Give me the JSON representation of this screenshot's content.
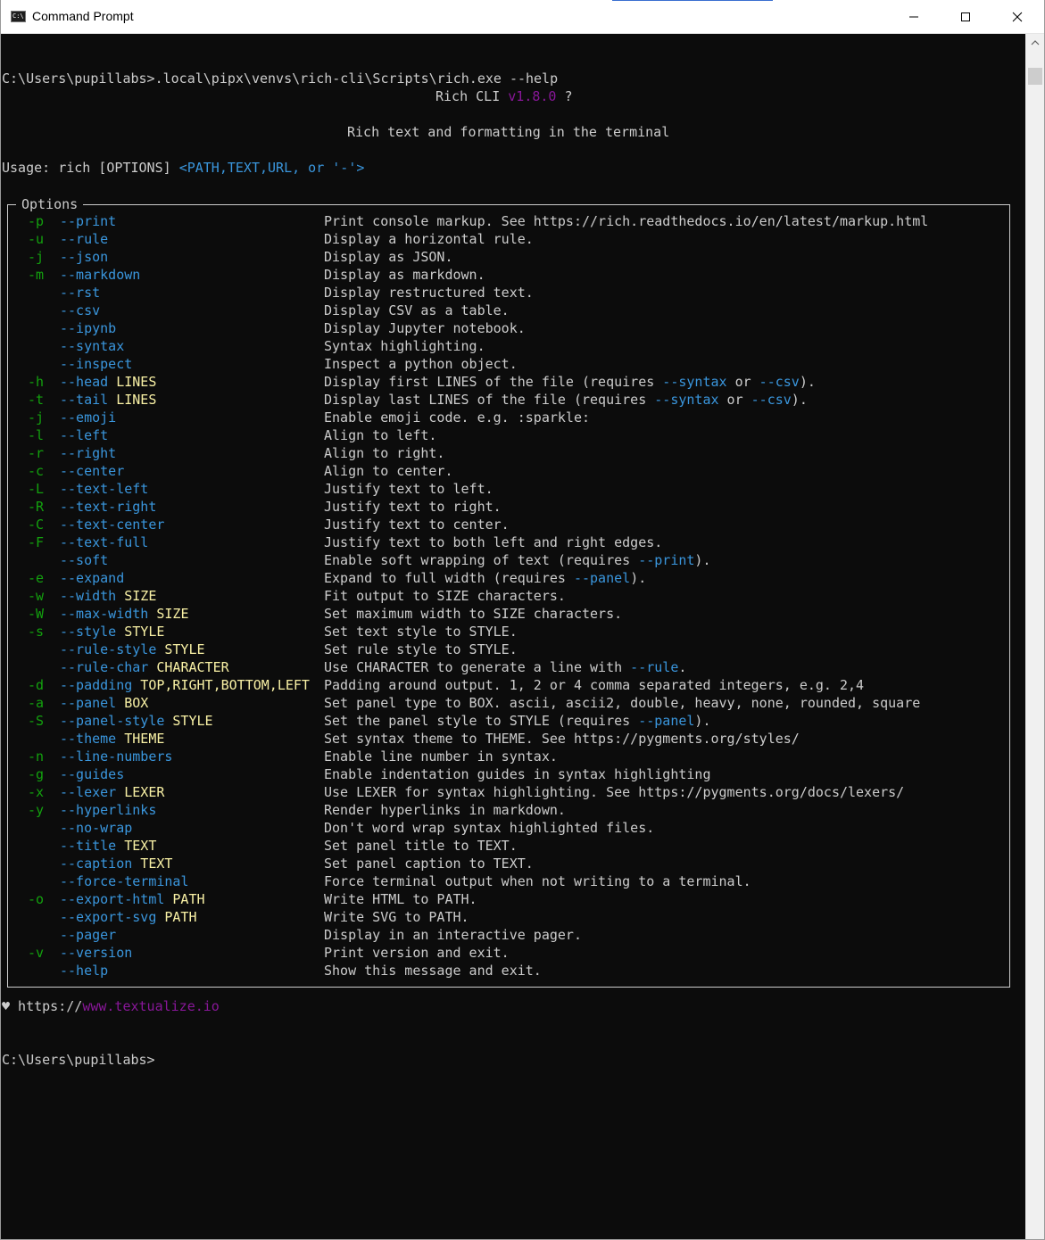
{
  "window": {
    "title": "Command Prompt",
    "icon": "cmd-icon",
    "controls": [
      "minimize-icon",
      "maximize-icon",
      "close-icon"
    ]
  },
  "colors": {
    "background": "#0c0c0c",
    "text": "#cccccc",
    "short_flag": "#13a10e",
    "long_flag": "#3a96dd",
    "metavar": "#f9f1a5",
    "version": "#881798"
  },
  "terminal": {
    "command_line": "C:\\Users\\pupillabs>.local\\pipx\\venvs\\rich-cli\\Scripts\\rich.exe --help",
    "header_name": "Rich CLI ",
    "header_version": "v1.8.0",
    "header_glyph": " ?",
    "tagline": "Rich text and formatting in the terminal",
    "usage_prefix": "Usage: rich [OPTIONS] ",
    "usage_args": "<PATH,TEXT,URL, or '-'>",
    "options_title": "Options",
    "options": [
      {
        "short": "-p",
        "long": "--print",
        "meta": "",
        "desc": [
          "Print console markup. See https://rich.readthedocs.io/en/latest/markup.html"
        ]
      },
      {
        "short": "-u",
        "long": "--rule",
        "meta": "",
        "desc": [
          "Display a horizontal rule."
        ]
      },
      {
        "short": "-j",
        "long": "--json",
        "meta": "",
        "desc": [
          "Display as JSON."
        ]
      },
      {
        "short": "-m",
        "long": "--markdown",
        "meta": "",
        "desc": [
          "Display as markdown."
        ]
      },
      {
        "short": "",
        "long": "--rst",
        "meta": "",
        "desc": [
          "Display restructured text."
        ]
      },
      {
        "short": "",
        "long": "--csv",
        "meta": "",
        "desc": [
          "Display CSV as a table."
        ]
      },
      {
        "short": "",
        "long": "--ipynb",
        "meta": "",
        "desc": [
          "Display Jupyter notebook."
        ]
      },
      {
        "short": "",
        "long": "--syntax",
        "meta": "",
        "desc": [
          "Syntax highlighting."
        ]
      },
      {
        "short": "",
        "long": "--inspect",
        "meta": "",
        "desc": [
          "Inspect a python object."
        ]
      },
      {
        "short": "-h",
        "long": "--head",
        "meta": "LINES",
        "desc": [
          "Display first LINES of the file (requires ",
          {
            "hl": "--syntax"
          },
          " or ",
          {
            "hl": "--csv"
          },
          ")."
        ]
      },
      {
        "short": "-t",
        "long": "--tail",
        "meta": "LINES",
        "desc": [
          "Display last LINES of the file (requires ",
          {
            "hl": "--syntax"
          },
          " or ",
          {
            "hl": "--csv"
          },
          ")."
        ]
      },
      {
        "short": "-j",
        "long": "--emoji",
        "meta": "",
        "desc": [
          "Enable emoji code. e.g. :sparkle:"
        ]
      },
      {
        "short": "-l",
        "long": "--left",
        "meta": "",
        "desc": [
          "Align to left."
        ]
      },
      {
        "short": "-r",
        "long": "--right",
        "meta": "",
        "desc": [
          "Align to right."
        ]
      },
      {
        "short": "-c",
        "long": "--center",
        "meta": "",
        "desc": [
          "Align to center."
        ]
      },
      {
        "short": "-L",
        "long": "--text-left",
        "meta": "",
        "desc": [
          "Justify text to left."
        ]
      },
      {
        "short": "-R",
        "long": "--text-right",
        "meta": "",
        "desc": [
          "Justify text to right."
        ]
      },
      {
        "short": "-C",
        "long": "--text-center",
        "meta": "",
        "desc": [
          "Justify text to center."
        ]
      },
      {
        "short": "-F",
        "long": "--text-full",
        "meta": "",
        "desc": [
          "Justify text to both left and right edges."
        ]
      },
      {
        "short": "",
        "long": "--soft",
        "meta": "",
        "desc": [
          "Enable soft wrapping of text (requires ",
          {
            "hl": "--print"
          },
          ")."
        ]
      },
      {
        "short": "-e",
        "long": "--expand",
        "meta": "",
        "desc": [
          "Expand to full width (requires ",
          {
            "hl": "--panel"
          },
          ")."
        ]
      },
      {
        "short": "-w",
        "long": "--width",
        "meta": "SIZE",
        "desc": [
          "Fit output to SIZE characters."
        ]
      },
      {
        "short": "-W",
        "long": "--max-width",
        "meta": "SIZE",
        "desc": [
          "Set maximum width to SIZE characters."
        ]
      },
      {
        "short": "-s",
        "long": "--style",
        "meta": "STYLE",
        "desc": [
          "Set text style to STYLE."
        ]
      },
      {
        "short": "",
        "long": "--rule-style",
        "meta": "STYLE",
        "desc": [
          "Set rule style to STYLE."
        ]
      },
      {
        "short": "",
        "long": "--rule-char",
        "meta": "CHARACTER",
        "desc": [
          "Use CHARACTER to generate a line with ",
          {
            "hl": "--rule"
          },
          "."
        ]
      },
      {
        "short": "-d",
        "long": "--padding",
        "meta": "TOP,RIGHT,BOTTOM,LEFT",
        "desc": [
          "Padding around output. 1, 2 or 4 comma separated integers, e.g. 2,4"
        ]
      },
      {
        "short": "-a",
        "long": "--panel",
        "meta": "BOX",
        "desc": [
          "Set panel type to BOX. ascii, ascii2, double, heavy, none, rounded, square"
        ]
      },
      {
        "short": "-S",
        "long": "--panel-style",
        "meta": "STYLE",
        "desc": [
          "Set the panel style to STYLE (requires ",
          {
            "hl": "--panel"
          },
          ")."
        ]
      },
      {
        "short": "",
        "long": "--theme",
        "meta": "THEME",
        "desc": [
          "Set syntax theme to THEME. See https://pygments.org/styles/"
        ]
      },
      {
        "short": "-n",
        "long": "--line-numbers",
        "meta": "",
        "desc": [
          "Enable line number in syntax."
        ]
      },
      {
        "short": "-g",
        "long": "--guides",
        "meta": "",
        "desc": [
          "Enable indentation guides in syntax highlighting"
        ]
      },
      {
        "short": "-x",
        "long": "--lexer",
        "meta": "LEXER",
        "desc": [
          "Use LEXER for syntax highlighting. See https://pygments.org/docs/lexers/"
        ]
      },
      {
        "short": "-y",
        "long": "--hyperlinks",
        "meta": "",
        "desc": [
          "Render hyperlinks in markdown."
        ]
      },
      {
        "short": "",
        "long": "--no-wrap",
        "meta": "",
        "desc": [
          "Don't word wrap syntax highlighted files."
        ]
      },
      {
        "short": "",
        "long": "--title",
        "meta": "TEXT",
        "desc": [
          "Set panel title to TEXT."
        ]
      },
      {
        "short": "",
        "long": "--caption",
        "meta": "TEXT",
        "desc": [
          "Set panel caption to TEXT."
        ]
      },
      {
        "short": "",
        "long": "--force-terminal",
        "meta": "",
        "desc": [
          "Force terminal output when not writing to a terminal."
        ]
      },
      {
        "short": "-o",
        "long": "--export-html",
        "meta": "PATH",
        "desc": [
          "Write HTML to PATH."
        ]
      },
      {
        "short": "",
        "long": "--export-svg",
        "meta": "PATH",
        "desc": [
          "Write SVG to PATH."
        ]
      },
      {
        "short": "",
        "long": "--pager",
        "meta": "",
        "desc": [
          "Display in an interactive pager."
        ]
      },
      {
        "short": "-v",
        "long": "--version",
        "meta": "",
        "desc": [
          "Print version and exit."
        ]
      },
      {
        "short": "",
        "long": "--help",
        "meta": "",
        "desc": [
          "Show this message and exit."
        ]
      }
    ],
    "footer_heart": "♥",
    "footer_prefix": " https://",
    "footer_link": "www.textualize.io",
    "prompt": "C:\\Users\\pupillabs>"
  }
}
